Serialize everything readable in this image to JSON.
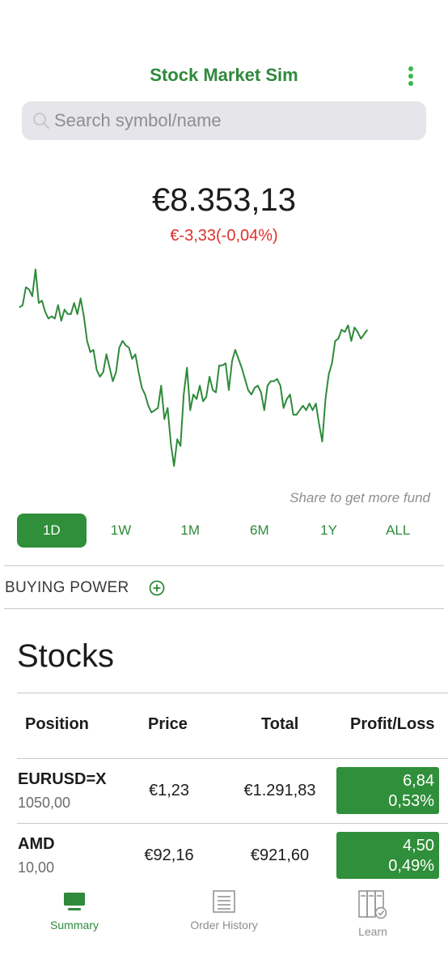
{
  "header": {
    "title": "Stock Market Sim",
    "menu_icon": "more-vertical-icon"
  },
  "search": {
    "placeholder": "Search symbol/name",
    "value": ""
  },
  "portfolio": {
    "value": "€8.353,13",
    "change": "€-3,33(-0,04%)",
    "share_note": "Share to get more fund"
  },
  "chart_data": {
    "type": "line",
    "title": "",
    "xlabel": "",
    "ylabel": "",
    "color": "#2f8a3b",
    "x": [
      1,
      2,
      3,
      4,
      5,
      6,
      7,
      8,
      9,
      10,
      11,
      12,
      13,
      14,
      15,
      16,
      17,
      18,
      19,
      20,
      21,
      22,
      23,
      24,
      25,
      26,
      27,
      28,
      29,
      30,
      31,
      32,
      33,
      34,
      35,
      36,
      37,
      38,
      39,
      40,
      41,
      42,
      43,
      44,
      45,
      46,
      47,
      48,
      49,
      50,
      51,
      52,
      53,
      54,
      55,
      56,
      57,
      58,
      59,
      60,
      61,
      62,
      63,
      64,
      65,
      66,
      67,
      68,
      69,
      70,
      71,
      72,
      73,
      74,
      75,
      76,
      77,
      78,
      79,
      80,
      81,
      82,
      83,
      84,
      85,
      86,
      87,
      88,
      89,
      90,
      91,
      92,
      93,
      94,
      95,
      96,
      97,
      98,
      99,
      100,
      101,
      102,
      103,
      104,
      105,
      106,
      107,
      108,
      109,
      110,
      111,
      112,
      113,
      114,
      115,
      116,
      117,
      118,
      119,
      120,
      121,
      122,
      123,
      124,
      125,
      126,
      127,
      128
    ],
    "values": [
      8392,
      8393,
      8401,
      8400,
      8397,
      8409,
      8394,
      8395,
      8390,
      8387,
      8388,
      8387,
      8393,
      8386,
      8391,
      8389,
      8389,
      8394,
      8389,
      8396,
      8388,
      8377,
      8372,
      8373,
      8364,
      8361,
      8363,
      8371,
      8365,
      8359,
      8363,
      8374,
      8377,
      8375,
      8374,
      8369,
      8371,
      8363,
      8356,
      8353,
      8348,
      8345,
      8346,
      8347,
      8357,
      8342,
      8347,
      8331,
      8321,
      8333,
      8330,
      8353,
      8365,
      8346,
      8353,
      8351,
      8357,
      8350,
      8352,
      8361,
      8355,
      8354,
      8366,
      8366,
      8367,
      8355,
      8368,
      8373,
      8369,
      8365,
      8360,
      8355,
      8353,
      8356,
      8357,
      8354,
      8346,
      8357,
      8359,
      8359,
      8360,
      8357,
      8347,
      8351,
      8353,
      8344,
      8344,
      8346,
      8348,
      8346,
      8349,
      8346,
      8349,
      8340,
      8332,
      8351,
      8362,
      8367,
      8377,
      8378,
      8382,
      8381,
      8384,
      8377,
      8383,
      8381,
      8378,
      8380,
      8382
    ],
    "ylim": [
      8315,
      8415
    ]
  },
  "ranges": [
    "1D",
    "1W",
    "1M",
    "6M",
    "1Y",
    "ALL"
  ],
  "buying_power": {
    "label": "BUYING POWER",
    "icon": "add-circle-icon"
  },
  "stocks": {
    "title": "Stocks",
    "columns": [
      "Position",
      "Price",
      "Total",
      "Profit/Loss"
    ],
    "rows": [
      {
        "symbol": "EURUSD=X",
        "qty": "1050,00",
        "price": "€1,23",
        "total": "€1.291,83",
        "pl_value": "6,84",
        "pl_pct": "0,53%"
      },
      {
        "symbol": "AMD",
        "qty": "10,00",
        "price": "€92,16",
        "total": "€921,60",
        "pl_value": "4,50",
        "pl_pct": "0,49%"
      }
    ]
  },
  "tabs": [
    {
      "label": "Summary",
      "icon": "monitor-icon",
      "active": true
    },
    {
      "label": "Order History",
      "icon": "list-document-icon",
      "active": false
    },
    {
      "label": "Learn",
      "icon": "book-check-icon",
      "active": false
    }
  ],
  "colors": {
    "brand": "#2f8a3b",
    "negative": "#e0302a",
    "positive_fill": "#2f8f3a"
  }
}
